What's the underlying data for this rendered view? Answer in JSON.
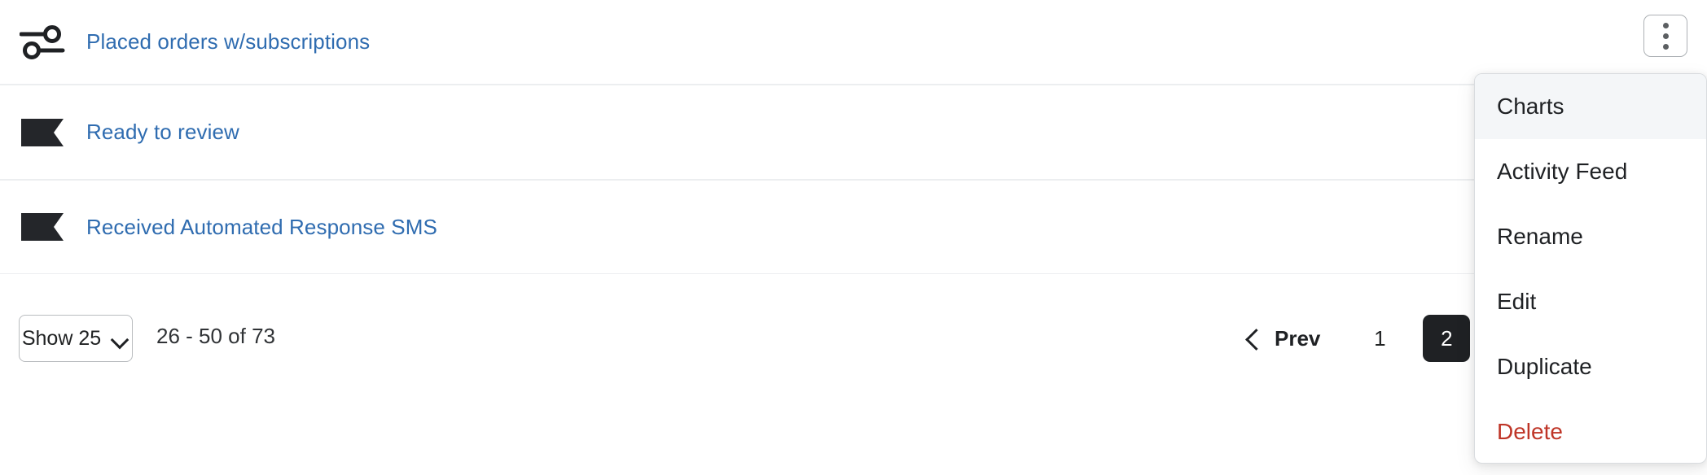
{
  "rows": [
    {
      "label": "Placed orders w/subscriptions",
      "icon": "segment-filter-icon",
      "icon_color": "#1f2124",
      "link_color": "#2f6cb0"
    },
    {
      "label": "Ready to review",
      "icon": "flag-banner-icon",
      "icon_color": "#24262a",
      "link_color": "#2f6cb0"
    },
    {
      "label": "Received Automated Response SMS",
      "icon": "flag-banner-icon",
      "icon_color": "#24262a",
      "link_color": "#2f6cb0"
    }
  ],
  "footer": {
    "page_size_label": "Show 25",
    "page_size_chevron": "chevron-down-icon",
    "range_text": "26 - 50 of 73",
    "prev_label": "Prev",
    "prev_chevron": "chevron-left-icon",
    "pages": [
      {
        "label": "1",
        "active": false
      },
      {
        "label": "2",
        "active": true
      }
    ]
  },
  "kebab_button": {
    "icon": "vertical-ellipsis-icon",
    "dots": 3
  },
  "dropdown": {
    "items": [
      {
        "label": "Charts",
        "hovered": true,
        "danger": false
      },
      {
        "label": "Activity Feed",
        "hovered": false,
        "danger": false
      },
      {
        "label": "Rename",
        "hovered": false,
        "danger": false
      },
      {
        "label": "Edit",
        "hovered": false,
        "danger": false
      },
      {
        "label": "Duplicate",
        "hovered": false,
        "danger": false
      },
      {
        "label": "Delete",
        "hovered": false,
        "danger": true
      }
    ],
    "danger_color": "#bf3527",
    "hover_color": "#f4f6f8"
  }
}
